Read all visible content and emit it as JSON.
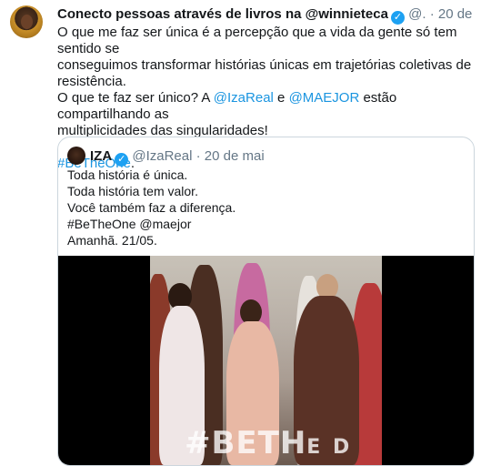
{
  "tweet": {
    "display_name": "Conecto pessoas através de livros na @winnieteca",
    "handle": "@.",
    "separator": "·",
    "date": "20 de mai",
    "line1": "O que me faz ser única é a percepção que a vida da gente só tem sentido se",
    "line2": "conseguimos transformar histórias únicas em trajetórias coletivas de",
    "line3": "resistência.",
    "line4_pre": "O que te faz ser único? A ",
    "mention1": "@IzaReal",
    "line4_mid": " e ",
    "mention2": "@MAEJOR",
    "line4_post": " estão compartilhando as",
    "line5": "multiplicidades das singularidades!",
    "hashtag": "#BeTheOne",
    "hashtag_suffix": "."
  },
  "quoted": {
    "display_name": "IZA",
    "handle": "@IzaReal",
    "separator": "·",
    "date": "20 de mai",
    "lines": [
      "Toda história é única.",
      "Toda história tem valor.",
      "Você também faz a diferença.",
      "#BeTheOne @maejor",
      "Amanhã. 21/05."
    ],
    "video_overlay": "#BETH",
    "video_overlay_tail": "E D"
  },
  "colors": {
    "link": "#1b95e0",
    "verified": "#1da1f2",
    "muted": "#657786",
    "border": "#ccd6dd"
  },
  "icons": {
    "verified": "verified-badge-icon"
  }
}
